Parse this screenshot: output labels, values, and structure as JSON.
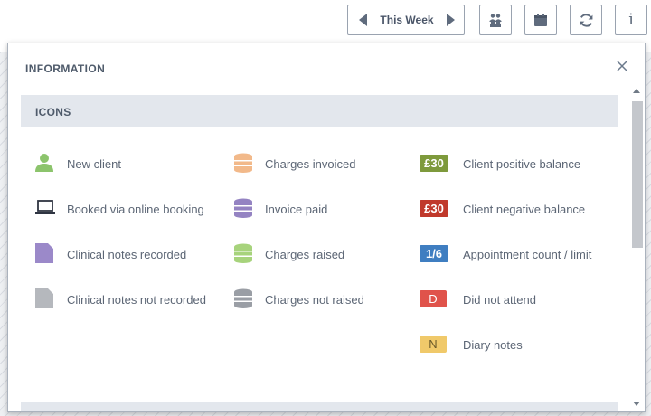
{
  "toolbar": {
    "week_label": "This Week",
    "info_glyph": "i"
  },
  "modal": {
    "title": "INFORMATION",
    "section_title": "ICONS",
    "columns": [
      {
        "items": [
          {
            "icon": "person-icon",
            "label": "New client",
            "color": "#8cc46c"
          },
          {
            "icon": "laptop-icon",
            "label": "Booked via online booking",
            "color": "#2f3542"
          },
          {
            "icon": "note-icon",
            "label": "Clinical notes recorded",
            "color": "#9b89c9"
          },
          {
            "icon": "note-icon",
            "label": "Clinical notes not recorded",
            "color": "#b5b8bd"
          }
        ]
      },
      {
        "items": [
          {
            "icon": "coins-icon",
            "label": "Charges invoiced",
            "color": "#f2b98a"
          },
          {
            "icon": "coins-icon",
            "label": "Invoice paid",
            "color": "#9483c2"
          },
          {
            "icon": "coins-icon",
            "label": "Charges raised",
            "color": "#a7d37c"
          },
          {
            "icon": "coins-icon",
            "label": "Charges not raised",
            "color": "#9a9ea5"
          }
        ]
      },
      {
        "items": [
          {
            "icon": "badge",
            "badge_text": "£30",
            "label": "Client positive balance",
            "color": "#7e9a3c"
          },
          {
            "icon": "badge",
            "badge_text": "£30",
            "label": "Client negative balance",
            "color": "#c0392b"
          },
          {
            "icon": "badge",
            "badge_text": "1/6",
            "label": "Appointment count / limit",
            "color": "#3f7ec1"
          },
          {
            "icon": "badge",
            "badge_text": "D",
            "label": "Did not attend",
            "color": "#e0534b"
          },
          {
            "icon": "badge",
            "badge_text": "N",
            "label": "Diary notes",
            "color": "#f0c96a",
            "text_color": "#6b5a2a"
          }
        ]
      }
    ]
  }
}
